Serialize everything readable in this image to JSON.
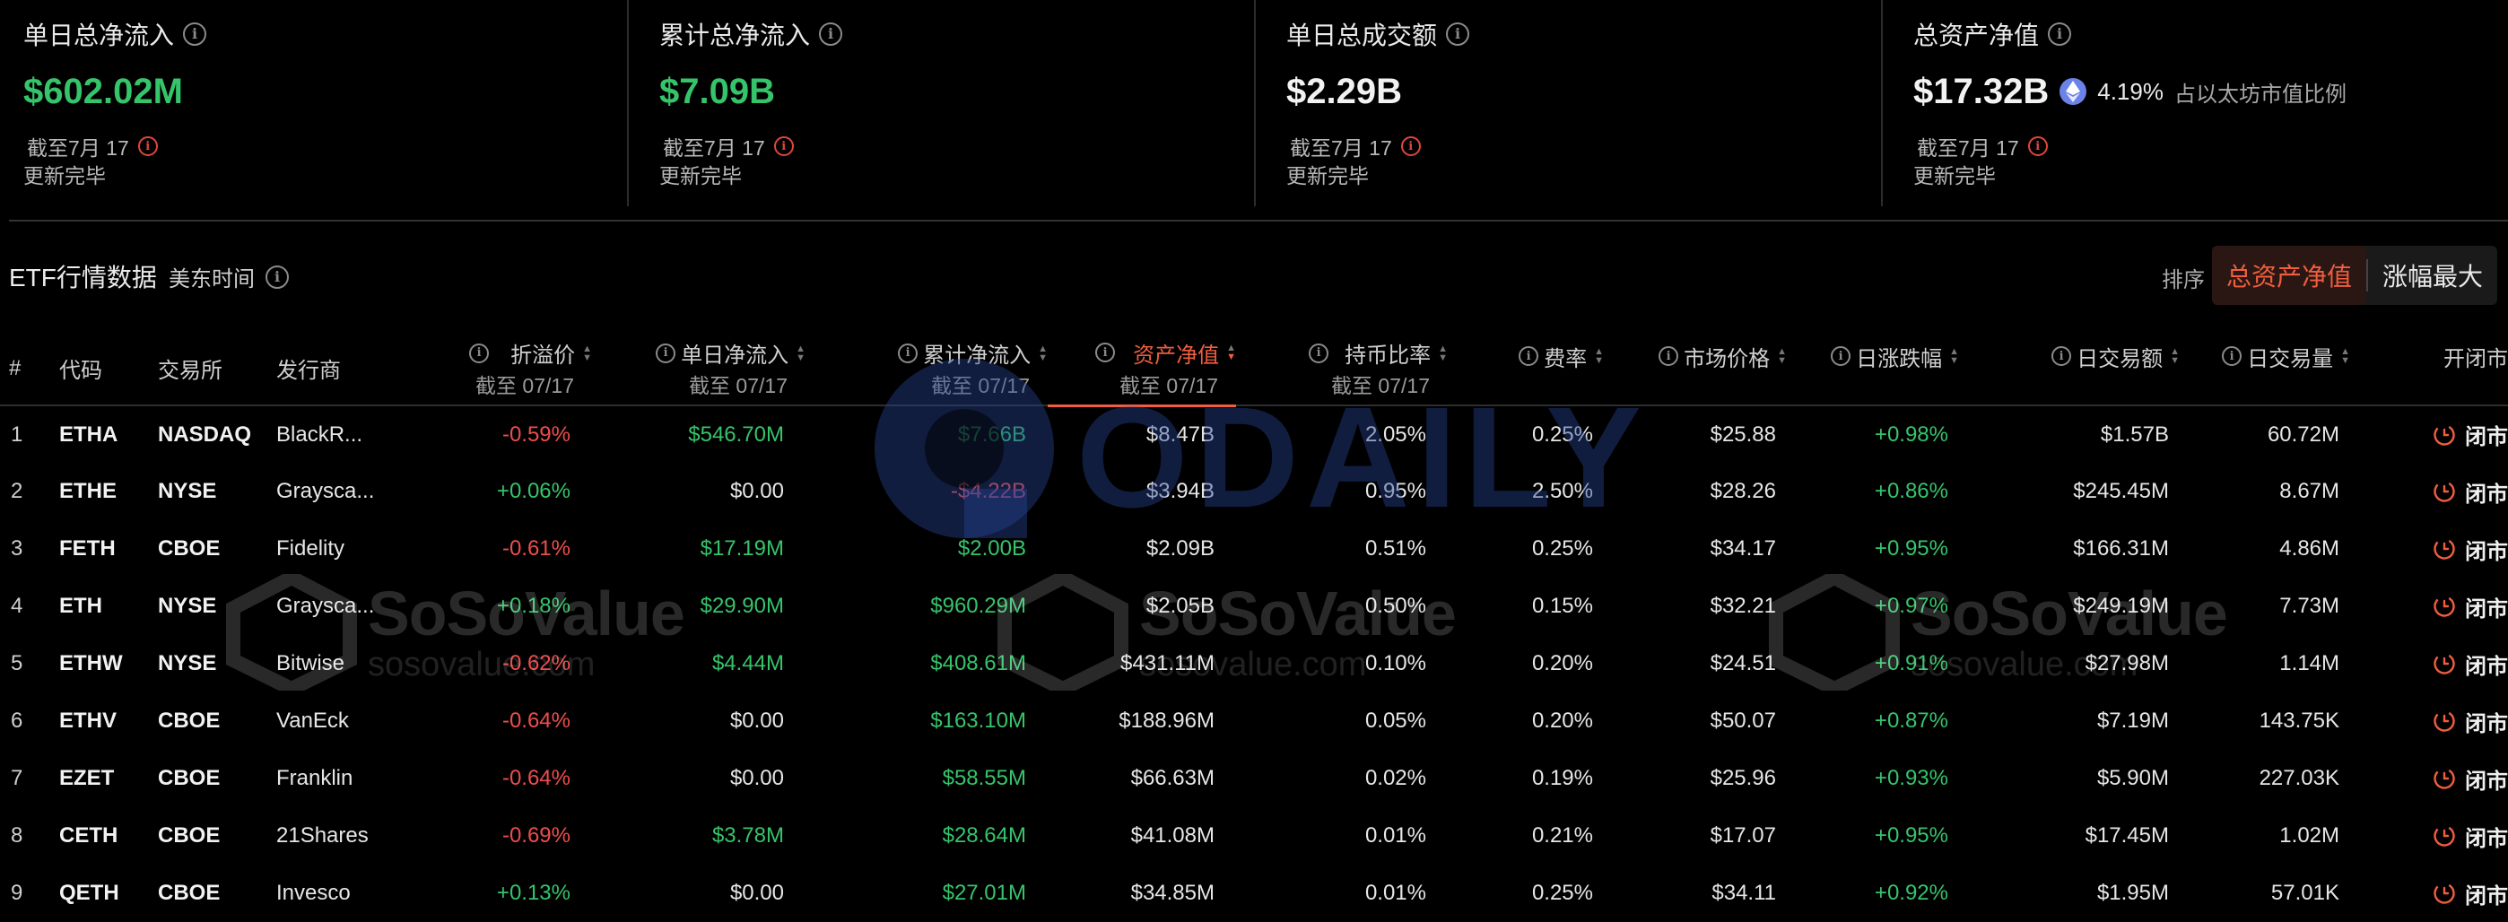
{
  "stats": [
    {
      "label": "单日总净流入",
      "value": "$602.02M",
      "asof": "截至7月 17",
      "status": "更新完毕",
      "tone": "green"
    },
    {
      "label": "累计总净流入",
      "value": "$7.09B",
      "asof": "截至7月 17",
      "status": "更新完毕",
      "tone": "green"
    },
    {
      "label": "单日总成交额",
      "value": "$2.29B",
      "asof": "截至7月 17",
      "status": "更新完毕",
      "tone": "white"
    },
    {
      "label": "总资产净值",
      "value": "$17.32B",
      "pct": "4.19%",
      "pct_note": "占以太坊市值比例",
      "asof": "截至7月 17",
      "status": "更新完毕",
      "tone": "white"
    }
  ],
  "toolbar": {
    "title": "ETF行情数据",
    "timezone": "美东时间",
    "sort_label": "排序",
    "sort_options": [
      "总资产净值",
      "涨幅最大"
    ]
  },
  "columns": {
    "index": "#",
    "ticker": "代码",
    "exchange": "交易所",
    "issuer": "发行商",
    "premium": "折溢价",
    "premium_sub": "截至 07/17",
    "daily_inflow": "单日净流入",
    "daily_inflow_sub": "截至 07/17",
    "cum_inflow": "累计净流入",
    "cum_inflow_sub": "截至 07/17",
    "nav": "资产净值",
    "nav_sub": "截至 07/17",
    "holding_ratio": "持币比率",
    "holding_ratio_sub": "截至 07/17",
    "fee": "费率",
    "price": "市场价格",
    "change": "日涨跌幅",
    "turnover": "日交易额",
    "volume": "日交易量",
    "market": "开闭市"
  },
  "rows": [
    {
      "i": "1",
      "ticker": "ETHA",
      "exchange": "NASDAQ",
      "issuer": "BlackR...",
      "premium": "-0.59%",
      "daily": "$546.70M",
      "cum": "$7.66B",
      "nav": "$8.47B",
      "ratio": "2.05%",
      "fee": "0.25%",
      "price": "$25.88",
      "change": "+0.98%",
      "turnover": "$1.57B",
      "volume": "60.72M",
      "market": "闭市"
    },
    {
      "i": "2",
      "ticker": "ETHE",
      "exchange": "NYSE",
      "issuer": "Graysca...",
      "premium": "+0.06%",
      "daily": "$0.00",
      "cum": "-$4.22B",
      "nav": "$3.94B",
      "ratio": "0.95%",
      "fee": "2.50%",
      "price": "$28.26",
      "change": "+0.86%",
      "turnover": "$245.45M",
      "volume": "8.67M",
      "market": "闭市"
    },
    {
      "i": "3",
      "ticker": "FETH",
      "exchange": "CBOE",
      "issuer": "Fidelity",
      "premium": "-0.61%",
      "daily": "$17.19M",
      "cum": "$2.00B",
      "nav": "$2.09B",
      "ratio": "0.51%",
      "fee": "0.25%",
      "price": "$34.17",
      "change": "+0.95%",
      "turnover": "$166.31M",
      "volume": "4.86M",
      "market": "闭市"
    },
    {
      "i": "4",
      "ticker": "ETH",
      "exchange": "NYSE",
      "issuer": "Graysca...",
      "premium": "+0.18%",
      "daily": "$29.90M",
      "cum": "$960.29M",
      "nav": "$2.05B",
      "ratio": "0.50%",
      "fee": "0.15%",
      "price": "$32.21",
      "change": "+0.97%",
      "turnover": "$249.19M",
      "volume": "7.73M",
      "market": "闭市"
    },
    {
      "i": "5",
      "ticker": "ETHW",
      "exchange": "NYSE",
      "issuer": "Bitwise",
      "premium": "-0.62%",
      "daily": "$4.44M",
      "cum": "$408.61M",
      "nav": "$431.11M",
      "ratio": "0.10%",
      "fee": "0.20%",
      "price": "$24.51",
      "change": "+0.91%",
      "turnover": "$27.98M",
      "volume": "1.14M",
      "market": "闭市"
    },
    {
      "i": "6",
      "ticker": "ETHV",
      "exchange": "CBOE",
      "issuer": "VanEck",
      "premium": "-0.64%",
      "daily": "$0.00",
      "cum": "$163.10M",
      "nav": "$188.96M",
      "ratio": "0.05%",
      "fee": "0.20%",
      "price": "$50.07",
      "change": "+0.87%",
      "turnover": "$7.19M",
      "volume": "143.75K",
      "market": "闭市"
    },
    {
      "i": "7",
      "ticker": "EZET",
      "exchange": "CBOE",
      "issuer": "Franklin",
      "premium": "-0.64%",
      "daily": "$0.00",
      "cum": "$58.55M",
      "nav": "$66.63M",
      "ratio": "0.02%",
      "fee": "0.19%",
      "price": "$25.96",
      "change": "+0.93%",
      "turnover": "$5.90M",
      "volume": "227.03K",
      "market": "闭市"
    },
    {
      "i": "8",
      "ticker": "CETH",
      "exchange": "CBOE",
      "issuer": "21Shares",
      "premium": "-0.69%",
      "daily": "$3.78M",
      "cum": "$28.64M",
      "nav": "$41.08M",
      "ratio": "0.01%",
      "fee": "0.21%",
      "price": "$17.07",
      "change": "+0.95%",
      "turnover": "$17.45M",
      "volume": "1.02M",
      "market": "闭市"
    },
    {
      "i": "9",
      "ticker": "QETH",
      "exchange": "CBOE",
      "issuer": "Invesco",
      "premium": "+0.13%",
      "daily": "$0.00",
      "cum": "$27.01M",
      "nav": "$34.85M",
      "ratio": "0.01%",
      "fee": "0.25%",
      "price": "$34.11",
      "change": "+0.92%",
      "turnover": "$1.95M",
      "volume": "57.01K",
      "market": "闭市"
    }
  ],
  "watermarks": {
    "brand": "SoSoValue",
    "domain": "sosovalue.com",
    "center": "ODAILY"
  },
  "colors": {
    "positive": "#36c46a",
    "negative": "#ee4d4d",
    "accent": "#f05e3f",
    "eth": "#6b82e8"
  },
  "icons": {
    "info": "info-icon",
    "eth": "ethereum-icon",
    "market": "clock-icon"
  }
}
